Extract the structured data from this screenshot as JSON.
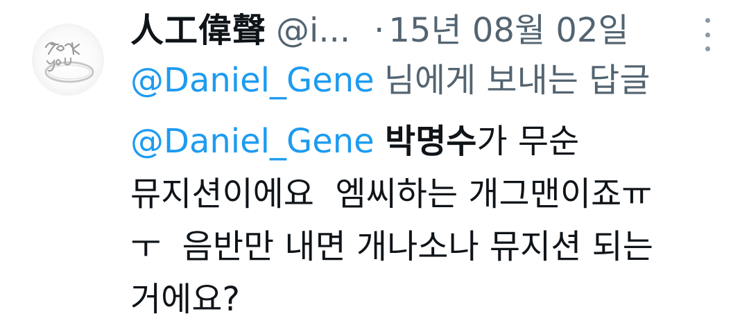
{
  "tweet": {
    "display_name": "人工偉聲",
    "handle": "@i...",
    "dot": "·",
    "date": "15년 08월 02일",
    "more_icon": "more-vertical-icon",
    "reply_to": {
      "mention": "@Daniel_Gene",
      "suffix": "님에게 보내는 답글"
    },
    "body": {
      "mention": "@Daniel_Gene",
      "space": " ",
      "strong": "박명수",
      "text": "가 무순\n뮤지션이에요  엠씨하는 개그맨이죠ㅠ\nㅜ  음반만 내면 개나소나 뮤지션 되는\n거에요?"
    },
    "avatar": {
      "icon": "ring-avatar-icon",
      "engraving": "fuck you"
    }
  }
}
